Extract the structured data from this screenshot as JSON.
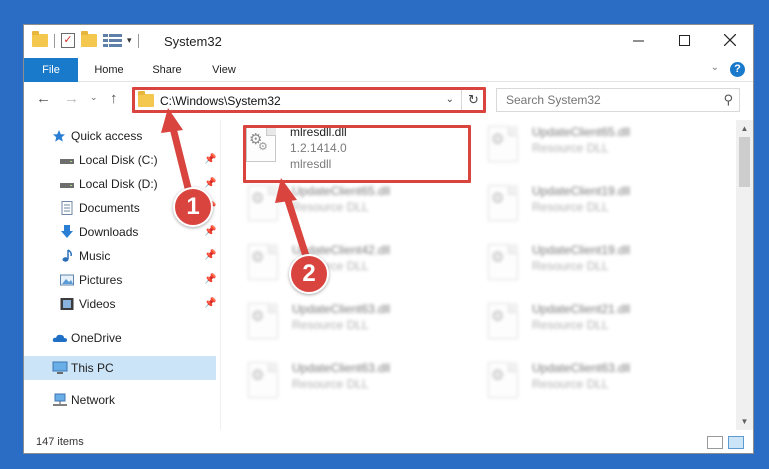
{
  "window": {
    "title": "System32",
    "minimize_icon": "minimize-icon",
    "maximize_icon": "maximize-icon",
    "close_icon": "close-icon"
  },
  "ribbon": {
    "tabs": [
      {
        "label": "File"
      },
      {
        "label": "Home"
      },
      {
        "label": "Share"
      },
      {
        "label": "View"
      }
    ],
    "help": "?"
  },
  "address": {
    "path": "C:\\Windows\\System32",
    "search_placeholder": "Search System32"
  },
  "nav": {
    "items": [
      {
        "label": "Quick access",
        "icon": "star-icon"
      },
      {
        "label": "Local Disk (C:)",
        "icon": "drive-icon"
      },
      {
        "label": "Local Disk (D:)",
        "icon": "drive-icon"
      },
      {
        "label": "Documents",
        "icon": "documents-icon"
      },
      {
        "label": "Downloads",
        "icon": "download-icon"
      },
      {
        "label": "Music",
        "icon": "music-icon"
      },
      {
        "label": "Pictures",
        "icon": "pictures-icon"
      },
      {
        "label": "Videos",
        "icon": "videos-icon"
      },
      {
        "label": "OneDrive",
        "icon": "cloud-icon"
      },
      {
        "label": "This PC",
        "icon": "computer-icon"
      },
      {
        "label": "Network",
        "icon": "network-icon"
      }
    ]
  },
  "files": [
    {
      "name": "mlresdll.dll",
      "type": "1.2.1414.0",
      "desc": "mlresdll"
    },
    {
      "name": "UpdateClient65.dll",
      "type": "Resource DLL"
    },
    {
      "name": "UpdateClient65.dll",
      "type": "Resource DLL"
    },
    {
      "name": "UpdateClient19.dll",
      "type": "Resource DLL"
    },
    {
      "name": "UpdateClient42.dll",
      "type": "Resource DLL"
    },
    {
      "name": "UpdateClient19.dll",
      "type": "Resource DLL"
    },
    {
      "name": "UpdateClient63.dll",
      "type": "Resource DLL"
    },
    {
      "name": "UpdateClient21.dll",
      "type": "Resource DLL"
    },
    {
      "name": "UpdateClient63.dll",
      "type": "Resource DLL"
    },
    {
      "name": "UpdateClient63.dll",
      "type": "Resource DLL"
    }
  ],
  "status": {
    "item_count": "147 items"
  },
  "annotations": {
    "step1": "1",
    "step2": "2",
    "color": "#d9443f"
  }
}
